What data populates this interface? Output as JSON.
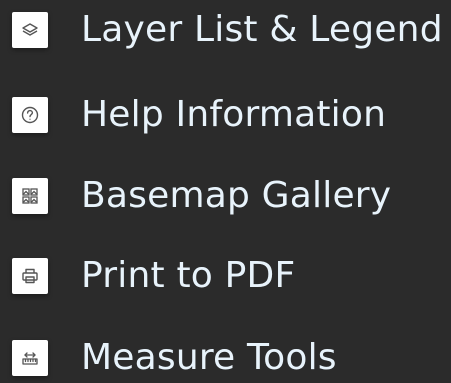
{
  "menu": {
    "items": [
      {
        "label": "Layer List & Legend",
        "icon": "layers-icon"
      },
      {
        "label": "Help Information",
        "icon": "help-icon"
      },
      {
        "label": "Basemap Gallery",
        "icon": "basemap-gallery-icon"
      },
      {
        "label": "Print to PDF",
        "icon": "print-icon"
      },
      {
        "label": "Measure Tools",
        "icon": "measure-icon"
      }
    ]
  },
  "colors": {
    "background": "#2b2b2b",
    "text": "#e8f3fb",
    "icon_bg": "#ffffff",
    "icon_stroke": "#555555"
  }
}
